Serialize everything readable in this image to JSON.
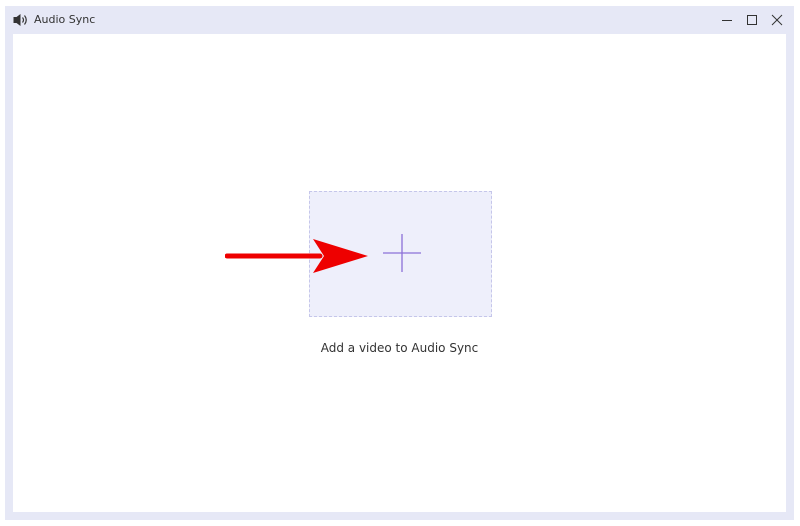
{
  "window": {
    "title": "Audio Sync",
    "app_icon": "speaker-icon",
    "controls": {
      "minimize_icon": "minimize-icon",
      "maximize_icon": "maximize-icon",
      "close_icon": "close-icon"
    }
  },
  "main": {
    "drop_zone_icon": "plus-icon",
    "hint": "Add a video to Audio Sync",
    "annotation_icon": "red-arrow-icon"
  },
  "colors": {
    "frame": "#e6e8f6",
    "drop_zone_bg": "#eeeffb",
    "drop_zone_border": "#c5c6ea",
    "accent": "#8c70d8",
    "annotation": "#ee0000"
  }
}
